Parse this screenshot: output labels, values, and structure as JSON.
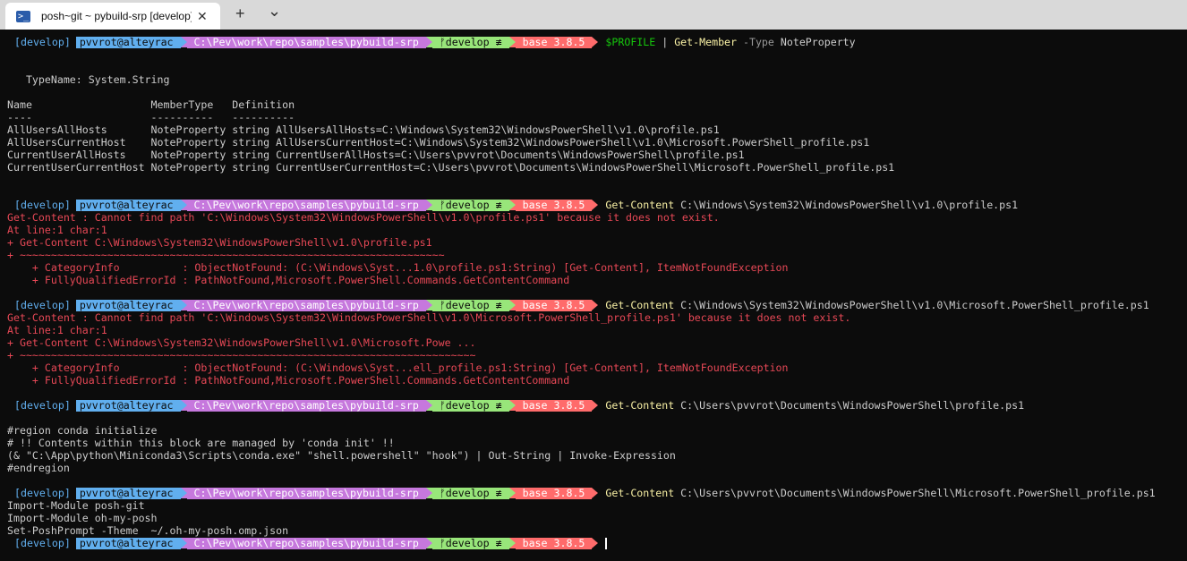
{
  "tab": {
    "title": "posh~git ~ pybuild-srp [develop]",
    "close": "✕",
    "new": "+",
    "dropdown": "⌄",
    "icon": ">_"
  },
  "prompt": {
    "branch": "[develop]",
    "user": "pvvrot@alteyrac",
    "path": "C:\\Pev\\work\\repo\\samples\\pybuild-srp",
    "git": "ᚠdevelop ≢",
    "conda": "base 3.8.5"
  },
  "lines": {
    "l01_cmd_a": "$PROFILE",
    "l01_cmd_b": " | ",
    "l01_cmd_c": "Get-Member",
    "l01_cmd_d": " -Type",
    "l01_cmd_e": " NoteProperty",
    "l02": "   TypeName: System.String",
    "l03": "Name                   MemberType   Definition",
    "l04": "----                   ----------   ----------",
    "l05": "AllUsersAllHosts       NoteProperty string AllUsersAllHosts=C:\\Windows\\System32\\WindowsPowerShell\\v1.0\\profile.ps1",
    "l06": "AllUsersCurrentHost    NoteProperty string AllUsersCurrentHost=C:\\Windows\\System32\\WindowsPowerShell\\v1.0\\Microsoft.PowerShell_profile.ps1",
    "l07": "CurrentUserAllHosts    NoteProperty string CurrentUserAllHosts=C:\\Users\\pvvrot\\Documents\\WindowsPowerShell\\profile.ps1",
    "l08": "CurrentUserCurrentHost NoteProperty string CurrentUserCurrentHost=C:\\Users\\pvvrot\\Documents\\WindowsPowerShell\\Microsoft.PowerShell_profile.ps1",
    "l09_kw": "Get-Content",
    "l09_arg": " C:\\Windows\\System32\\WindowsPowerShell\\v1.0\\profile.ps1",
    "e1_1": "Get-Content : Cannot find path 'C:\\Windows\\System32\\WindowsPowerShell\\v1.0\\profile.ps1' because it does not exist.",
    "e1_2": "At line:1 char:1",
    "e1_3": "+ Get-Content C:\\Windows\\System32\\WindowsPowerShell\\v1.0\\profile.ps1",
    "e1_4": "+ ~~~~~~~~~~~~~~~~~~~~~~~~~~~~~~~~~~~~~~~~~~~~~~~~~~~~~~~~~~~~~~~~~~~~",
    "e1_5": "    + CategoryInfo          : ObjectNotFound: (C:\\Windows\\Syst...1.0\\profile.ps1:String) [Get-Content], ItemNotFoundException",
    "e1_6": "    + FullyQualifiedErrorId : PathNotFound,Microsoft.PowerShell.Commands.GetContentCommand",
    "l10_kw": "Get-Content",
    "l10_arg": " C:\\Windows\\System32\\WindowsPowerShell\\v1.0\\Microsoft.PowerShell_profile.ps1",
    "e2_1": "Get-Content : Cannot find path 'C:\\Windows\\System32\\WindowsPowerShell\\v1.0\\Microsoft.PowerShell_profile.ps1' because it does not exist.",
    "e2_2": "At line:1 char:1",
    "e2_3": "+ Get-Content C:\\Windows\\System32\\WindowsPowerShell\\v1.0\\Microsoft.Powe ...",
    "e2_4": "+ ~~~~~~~~~~~~~~~~~~~~~~~~~~~~~~~~~~~~~~~~~~~~~~~~~~~~~~~~~~~~~~~~~~~~~~~~~",
    "e2_5": "    + CategoryInfo          : ObjectNotFound: (C:\\Windows\\Syst...ell_profile.ps1:String) [Get-Content], ItemNotFoundException",
    "e2_6": "    + FullyQualifiedErrorId : PathNotFound,Microsoft.PowerShell.Commands.GetContentCommand",
    "l11_kw": "Get-Content",
    "l11_arg": " C:\\Users\\pvvrot\\Documents\\WindowsPowerShell\\profile.ps1",
    "o1": "#region conda initialize",
    "o2": "# !! Contents within this block are managed by 'conda init' !!",
    "o3": "(& \"C:\\App\\python\\Miniconda3\\Scripts\\conda.exe\" \"shell.powershell\" \"hook\") | Out-String | Invoke-Expression",
    "o4": "#endregion",
    "l12_kw": "Get-Content",
    "l12_arg": " C:\\Users\\pvvrot\\Documents\\WindowsPowerShell\\Microsoft.PowerShell_profile.ps1",
    "o5": "Import-Module posh-git",
    "o6": "Import-Module oh-my-posh",
    "o7": "Set-PoshPrompt -Theme  ~/.oh-my-posh.omp.json"
  }
}
